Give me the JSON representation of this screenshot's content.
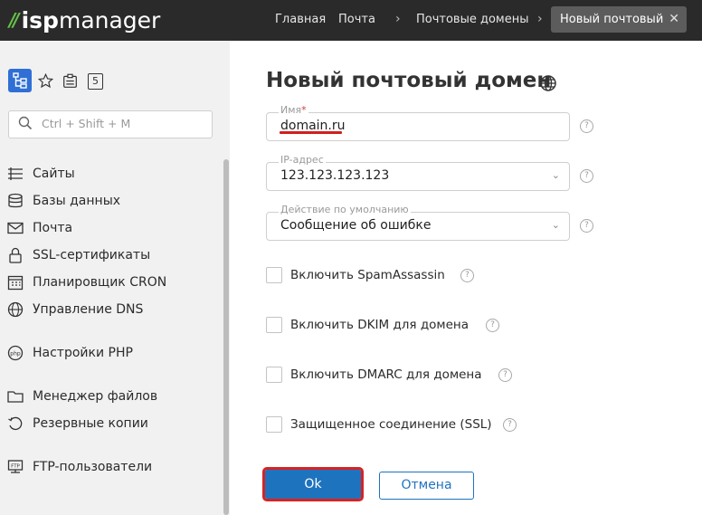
{
  "header": {
    "logo_isp": "isp",
    "logo_manager": "manager",
    "breadcrumbs": [
      "Главная",
      "Почта",
      "Почтовые домены"
    ],
    "active_tab": "Новый почтовый д...",
    "close_glyph": "✕"
  },
  "sidebar": {
    "top_icons": [
      "tree-icon",
      "star-icon",
      "clipboard-icon",
      "badge-5-icon"
    ],
    "badge_number": "5",
    "search_placeholder": "Ctrl + Shift + M",
    "items": [
      {
        "label": "Сайты",
        "icon": "sites-icon"
      },
      {
        "label": "Базы данных",
        "icon": "database-icon"
      },
      {
        "label": "Почта",
        "icon": "mail-icon"
      },
      {
        "label": "SSL-сертификаты",
        "icon": "lock-icon"
      },
      {
        "label": "Планировщик CRON",
        "icon": "calendar-icon"
      },
      {
        "label": "Управление DNS",
        "icon": "dns-icon"
      },
      {
        "label": "Настройки PHP",
        "icon": "php-icon"
      },
      {
        "label": "Менеджер файлов",
        "icon": "folder-icon"
      },
      {
        "label": "Резервные копии",
        "icon": "backup-icon"
      },
      {
        "label": "FTP-пользователи",
        "icon": "ftp-icon"
      }
    ]
  },
  "form": {
    "title": "Новый почтовый домен",
    "name_label": "Имя",
    "name_required_mark": "*",
    "name_value": "domain.ru",
    "ip_label": "IP-адрес",
    "ip_value": "123.123.123.123",
    "action_label": "Действие по умолчанию",
    "action_value": "Сообщение об ошибке",
    "checkboxes": [
      {
        "label": "Включить SpamAssassin",
        "checked": false
      },
      {
        "label": "Включить DKIM для домена",
        "checked": false
      },
      {
        "label": "Включить DMARC для домена",
        "checked": false
      },
      {
        "label": "Защищенное соединение (SSL)",
        "checked": false
      }
    ],
    "help_glyph": "?",
    "ok_label": "Ok",
    "cancel_label": "Отмена"
  },
  "colors": {
    "topbar": "#2a2a2a",
    "logo_accent": "#66c24a",
    "primary": "#1e73be",
    "highlight": "#d82222",
    "sidebar_bg": "#f1f1f1"
  }
}
